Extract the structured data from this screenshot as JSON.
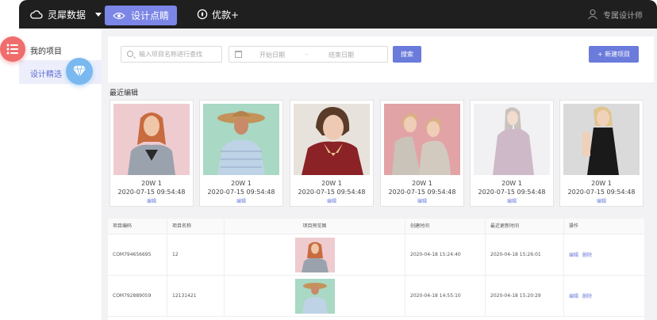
{
  "nav": {
    "brand": "灵犀数据",
    "active_tab": "设计点睛",
    "tab2": "优款+",
    "user": "专属设计师"
  },
  "sidebar": {
    "items": [
      {
        "label": "我的项目"
      },
      {
        "label": "设计精选"
      }
    ]
  },
  "search": {
    "placeholder": "输入项目名称进行查找",
    "start_date": "开始日期",
    "dash": "-",
    "end_date": "结束日期",
    "search_button": "搜索",
    "new_button": "+ 新建项目"
  },
  "recent": {
    "title": "最近编辑",
    "cards": [
      {
        "title": "20W 1",
        "date": "2020-07-15 09:54:48",
        "edit": "编辑"
      },
      {
        "title": "20W 1",
        "date": "2020-07-15 09:54:48",
        "edit": "编辑"
      },
      {
        "title": "20W 1",
        "date": "2020-07-15 09:54:48",
        "edit": "编辑"
      },
      {
        "title": "20W 1",
        "date": "2020-07-15 09:54:48",
        "edit": "编辑"
      },
      {
        "title": "20W 1",
        "date": "2020-07-15 09:54:48",
        "edit": "编辑"
      },
      {
        "title": "20W 1",
        "date": "2020-07-15 09:54:48",
        "edit": "编辑"
      }
    ]
  },
  "table": {
    "headers": [
      "项目编码",
      "项目名称",
      "项目预览图",
      "创建时间",
      "最近更新时间",
      "操作"
    ],
    "rows": [
      {
        "code": "COM794656695",
        "name": "12",
        "created": "2020-04-18 15:24:40",
        "updated": "2020-04-18 15:26:01",
        "edit": "编辑",
        "delete": "删除"
      },
      {
        "code": "COM792889059",
        "name": "12131421",
        "created": "2020-04-18 14:55:10",
        "updated": "2020-04-18 15:20:29",
        "edit": "编辑",
        "delete": "删除"
      }
    ]
  },
  "colors": {
    "accent": "#6b7bdb",
    "topbar": "#1f1f1f",
    "float_menu": "#f06d6d",
    "float_gem": "#7ab8f0"
  }
}
